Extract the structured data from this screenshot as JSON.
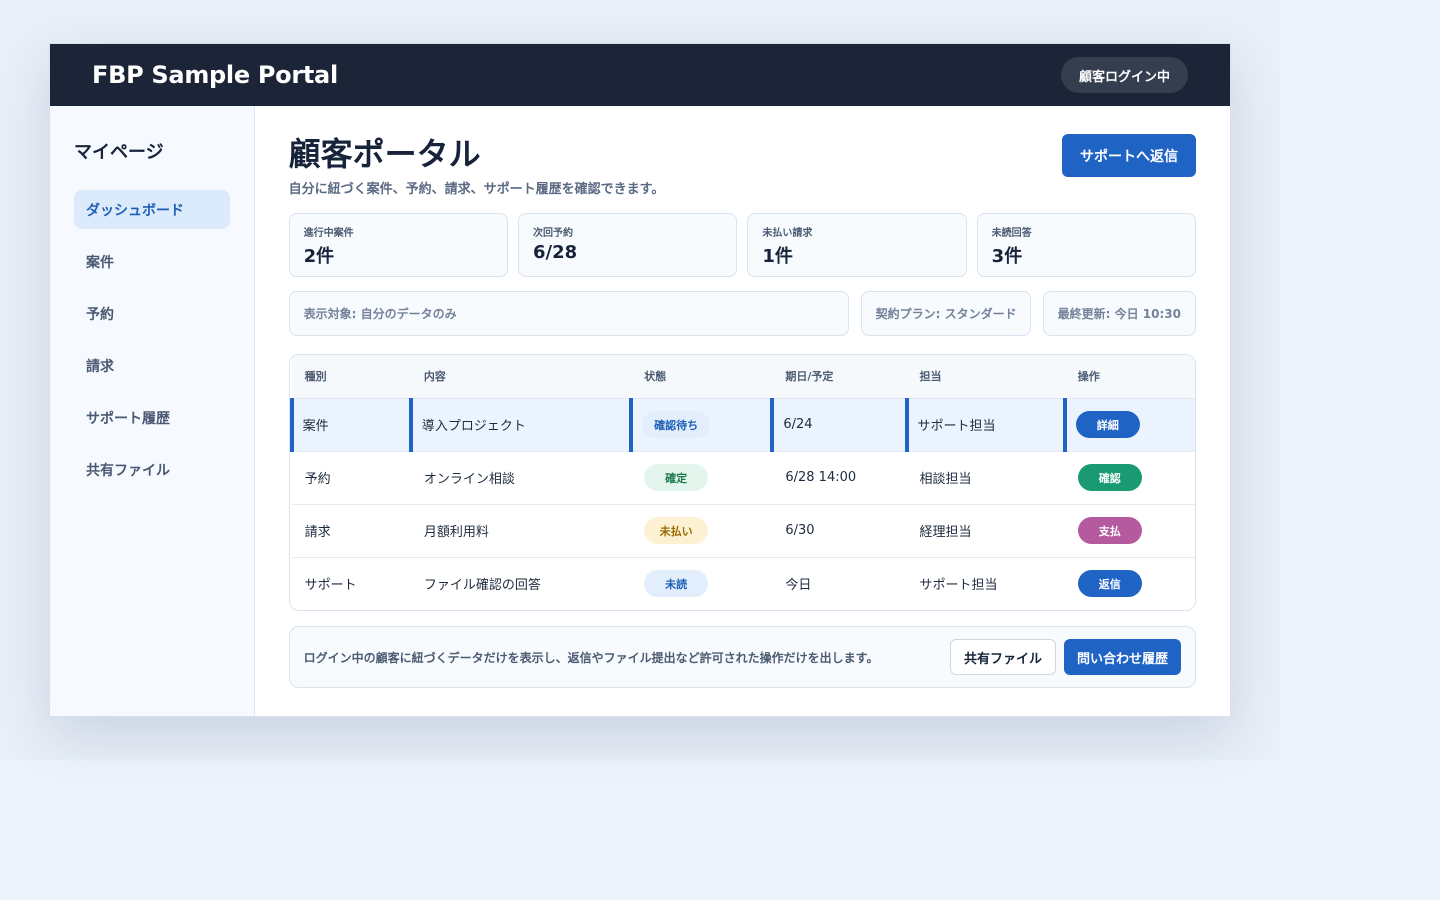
{
  "app": {
    "title": "FBP Sample Portal",
    "login_badge": "顧客ログイン中"
  },
  "sidebar": {
    "heading": "マイページ",
    "items": [
      {
        "label": "ダッシュボード",
        "active": true
      },
      {
        "label": "案件"
      },
      {
        "label": "予約"
      },
      {
        "label": "請求"
      },
      {
        "label": "サポート履歴"
      },
      {
        "label": "共有ファイル"
      }
    ]
  },
  "header": {
    "title": "顧客ポータル",
    "subtitle": "自分に紐づく案件、予約、請求、サポート履歴を確認できます。",
    "reply_button": "サポートへ返信"
  },
  "stats": [
    {
      "label": "進行中案件",
      "value": "2件"
    },
    {
      "label": "次回予約",
      "value": "6/28"
    },
    {
      "label": "未払い請求",
      "value": "1件"
    },
    {
      "label": "未読回答",
      "value": "3件"
    }
  ],
  "info": {
    "target": "表示対象: 自分のデータのみ",
    "plan": "契約プラン: スタンダード",
    "updated": "最終更新: 今日 10:30"
  },
  "table": {
    "columns": [
      "種別",
      "内容",
      "状態",
      "期日/予定",
      "担当",
      "操作"
    ],
    "rows": [
      {
        "type": "案件",
        "content": "導入プロジェクト",
        "status": "確認待ち",
        "date": "6/24",
        "owner": "サポート担当",
        "action": "詳細",
        "selected": true
      },
      {
        "type": "予約",
        "content": "オンライン相談",
        "status": "確定",
        "date": "6/28 14:00",
        "owner": "相談担当",
        "action": "確認"
      },
      {
        "type": "請求",
        "content": "月額利用料",
        "status": "未払い",
        "date": "6/30",
        "owner": "経理担当",
        "action": "支払"
      },
      {
        "type": "サポート",
        "content": "ファイル確認の回答",
        "status": "未読",
        "date": "今日",
        "owner": "サポート担当",
        "action": "返信"
      }
    ]
  },
  "colors": {
    "primary": "#1f63c5",
    "action_detail": "#1f63c5",
    "action_confirm": "#1a9a73",
    "action_pay": "#b55a9e",
    "action_reply": "#1f63c5"
  },
  "footer": {
    "note": "ログイン中の顧客に紐づくデータだけを表示し、返信やファイル提出など許可された操作だけを出します。",
    "shared_files_button": "共有ファイル",
    "history_button": "問い合わせ履歴"
  }
}
